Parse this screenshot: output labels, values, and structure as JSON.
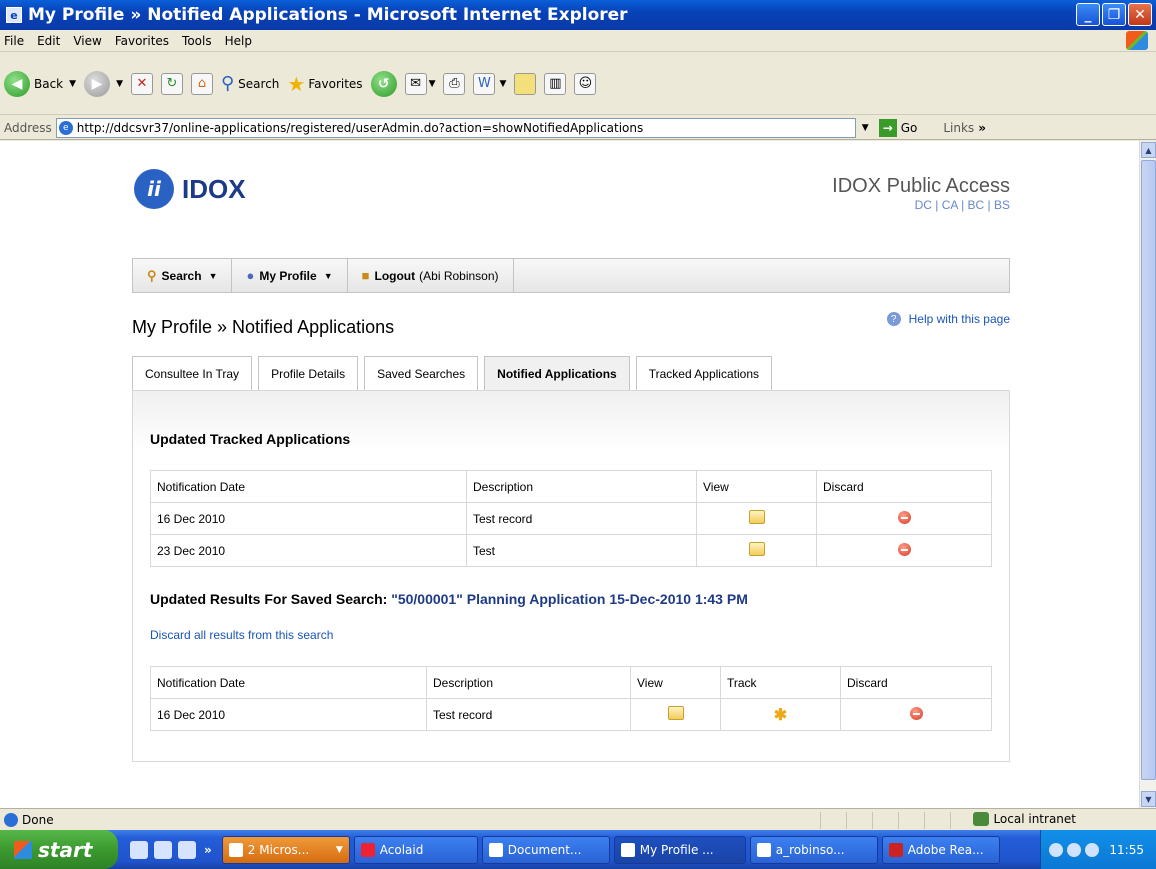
{
  "window": {
    "title": "My Profile » Notified Applications - Microsoft Internet Explorer"
  },
  "menu": [
    "File",
    "Edit",
    "View",
    "Favorites",
    "Tools",
    "Help"
  ],
  "toolbar": {
    "back": "Back",
    "search": "Search",
    "favorites": "Favorites"
  },
  "address": {
    "label": "Address",
    "url": "http://ddcsvr37/online-applications/registered/userAdmin.do?action=showNotifiedApplications",
    "go": "Go",
    "links": "Links"
  },
  "header": {
    "logo_text": "IDOX",
    "public_access": "IDOX Public Access",
    "modules": "DC | CA | BC | BS"
  },
  "nav": {
    "search": "Search",
    "my_profile": "My Profile",
    "logout": "Logout",
    "user": "(Abi Robinson)"
  },
  "page": {
    "title": "My Profile » Notified Applications",
    "help": "Help with this page"
  },
  "tabs": [
    "Consultee In Tray",
    "Profile Details",
    "Saved Searches",
    "Notified Applications",
    "Tracked Applications"
  ],
  "tracked": {
    "heading": "Updated Tracked Applications",
    "columns": [
      "Notification Date",
      "Description",
      "View",
      "Discard"
    ],
    "rows": [
      {
        "date": "16 Dec 2010",
        "description": "Test record"
      },
      {
        "date": "23 Dec 2010",
        "description": "Test"
      }
    ]
  },
  "saved": {
    "heading": "Updated Results For Saved Search:",
    "query": "\"50/00001\" Planning Application 15-Dec-2010 1:43 PM",
    "discard_all": "Discard all results from this search",
    "columns": [
      "Notification Date",
      "Description",
      "View",
      "Track",
      "Discard"
    ],
    "rows": [
      {
        "date": "16 Dec 2010",
        "description": "Test record"
      }
    ]
  },
  "status": {
    "text": "Done",
    "zone": "Local intranet"
  },
  "taskbar": {
    "start": "start",
    "tasks": [
      "2 Micros...",
      "Acolaid",
      "Document...",
      "My Profile ...",
      "a_robinso...",
      "Adobe Rea..."
    ],
    "clock": "11:55"
  }
}
